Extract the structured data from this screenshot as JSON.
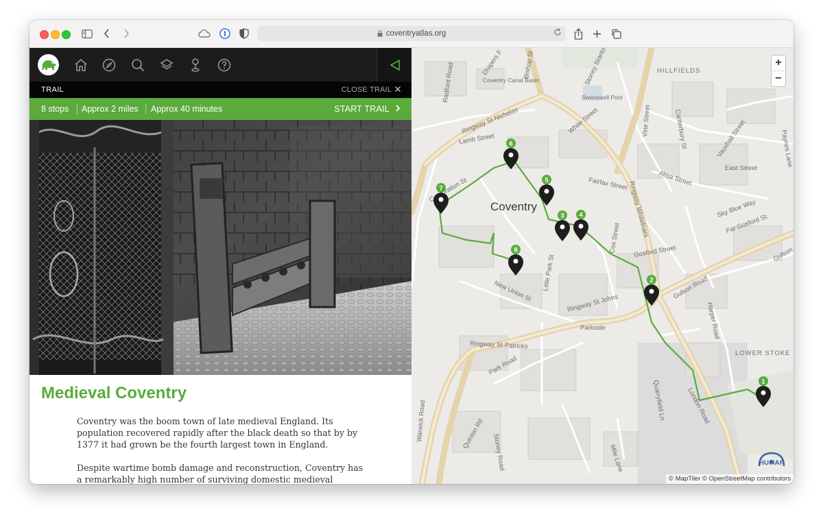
{
  "browser": {
    "url": "coventryatlas.org"
  },
  "nav": {
    "icons": [
      "elephant-logo-icon",
      "home-icon",
      "compass-icon",
      "search-icon",
      "layers-icon",
      "pin-icon",
      "help-icon",
      "back-triangle-icon"
    ]
  },
  "trail_bar": {
    "label": "TRAIL",
    "close": "CLOSE TRAIL"
  },
  "stats": {
    "stops": "8 stops",
    "distance": "Approx 2 miles",
    "duration": "Approx 40 minutes",
    "start": "START TRAIL"
  },
  "article": {
    "title": "Medieval Coventry",
    "paragraphs": [
      "Coventry was the boom town of late medieval England. Its population recovered rapidly after the black death so that by by 1377 it had grown be the fourth largest town in England.",
      "Despite wartime bomb damage and reconstruction, Coventry has a remarkably high number of surviving domestic medieval buildings."
    ]
  },
  "map": {
    "city_label": "Coventry",
    "zoom_in": "+",
    "zoom_out": "−",
    "attribution": "© MapTiler © OpenStreetMap contributors",
    "brand": "HUMAP",
    "area_labels": [
      "HILLFIELDS",
      "LOWER STOKE",
      "Parkside"
    ],
    "streets": [
      "Radford Road",
      "Drapers F",
      "Bishop St",
      "Coventry Canal Basin",
      "Stoney Stanton",
      "Swanswell Pool",
      "Ringway St Nicholas",
      "Lamb Street",
      "White Street",
      "Vine Street",
      "Canterbury St",
      "Vauxhall Street",
      "Paynes Lane",
      "East Street",
      "Alma Street",
      "Fairfax Street",
      "Corporation St",
      "Ringway Whitefriars",
      "Sky Blue Way",
      "Far Gosford St.",
      "Cox Street",
      "Gosford Street",
      "Little Park St",
      "New Union St",
      "Ringway St Johns",
      "Gulson Road",
      "Harper Road",
      "Gulson",
      "Ringway St Patricks",
      "Park Road",
      "Quinton Rd",
      "Stoney Road",
      "London Road",
      "Mile Lane",
      "Warwick Road",
      "Quarryfield Ln"
    ],
    "stops": [
      "1",
      "2",
      "3",
      "4",
      "5",
      "6",
      "7",
      "8"
    ],
    "route_color": "#5aab3c",
    "marker_color": "#1e1e1e"
  },
  "colors": {
    "accent": "#5aab3c",
    "nav_bg": "#1c1c1c",
    "trail_bg": "#050505"
  }
}
